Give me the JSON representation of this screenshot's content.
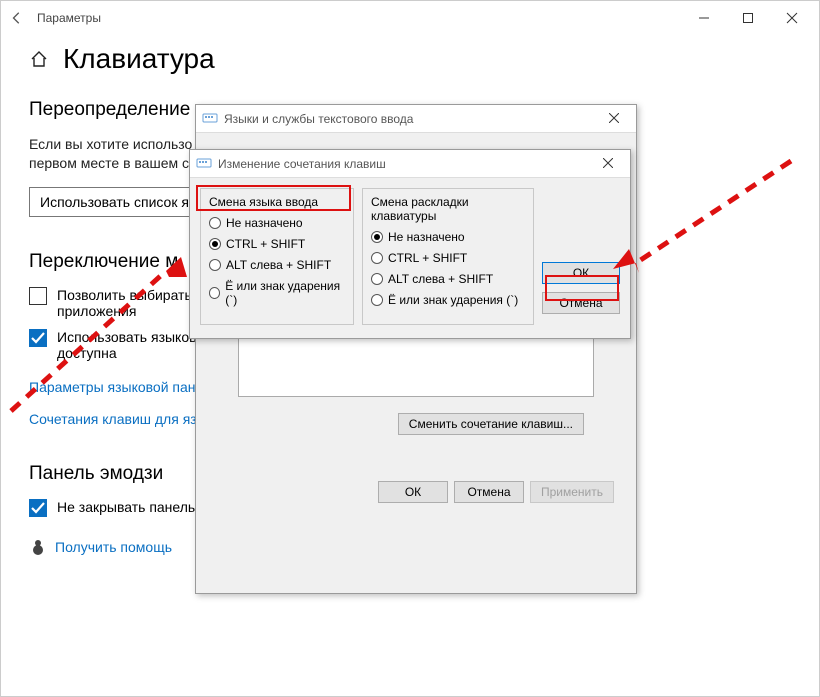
{
  "window": {
    "title": "Параметры"
  },
  "page": {
    "title": "Клавиатура",
    "section_override": "Переопределение",
    "override_para_l1": "Если вы хотите использо",
    "override_para_l2": "первом месте в вашем с",
    "use_list_btn": "Использовать список я",
    "section_switch": "Переключение м",
    "allow_choose_l1": "Позволить выбирать м",
    "allow_choose_l2": "приложения",
    "use_langbar_l1": "Использовать языкову",
    "use_langbar_l2": "доступна",
    "link_langbar": "Параметры языковой пане",
    "link_hotkeys": "Сочетания клавиш для язы",
    "section_emoji": "Панель эмодзи",
    "emoji_check": "Не закрывать панель автоматически после ввода эмодзи",
    "get_help": "Получить помощь"
  },
  "dlg_lang": {
    "title": "Языки и службы текстового ввода",
    "change_btn": "Сменить сочетание клавиш...",
    "ok": "ОК",
    "cancel": "Отмена",
    "apply": "Применить"
  },
  "dlg_keys": {
    "title": "Изменение сочетания клавиш",
    "group1": "Смена языка ввода",
    "group2": "Смена раскладки клавиатуры",
    "opt_none": "Не назначено",
    "opt_ctrl": "CTRL + SHIFT",
    "opt_alt": "ALT слева + SHIFT",
    "opt_accent": "Ё или знак ударения (`)",
    "ok": "ОК",
    "cancel": "Отмена"
  }
}
